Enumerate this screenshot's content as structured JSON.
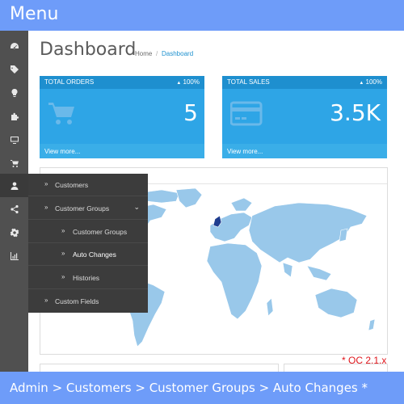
{
  "banner": {
    "title": "Menu"
  },
  "sidebar": {
    "icons": [
      {
        "name": "dashboard-icon"
      },
      {
        "name": "tags-icon"
      },
      {
        "name": "lightbulb-icon"
      },
      {
        "name": "puzzle-icon"
      },
      {
        "name": "desktop-icon"
      },
      {
        "name": "cart-icon"
      },
      {
        "name": "user-icon"
      },
      {
        "name": "share-icon"
      },
      {
        "name": "gear-icon"
      },
      {
        "name": "bar-chart-icon"
      }
    ]
  },
  "header": {
    "title": "Dashboard",
    "breadcrumb": {
      "home": "Home",
      "separator": "/",
      "current": "Dashboard"
    }
  },
  "tiles": [
    {
      "heading": "TOTAL ORDERS",
      "change": "100%",
      "value": "5",
      "link": "View more...",
      "icon": "cart-icon"
    },
    {
      "heading": "TOTAL SALES",
      "change": "100%",
      "value": "3.5K",
      "link": "View more...",
      "icon": "credit-card-icon"
    }
  ],
  "flyout": {
    "items": [
      {
        "label": "Customers",
        "level": 0
      },
      {
        "label": "Customer Groups",
        "level": 0,
        "expanded": true
      },
      {
        "label": "Customer Groups",
        "level": 1
      },
      {
        "label": "Auto Changes",
        "level": 1,
        "current": true
      },
      {
        "label": "Histories",
        "level": 1
      },
      {
        "label": "Custom Fields",
        "level": 0
      }
    ]
  },
  "note": "* OC 2.1.x",
  "footer": {
    "path": "Admin > Customers > Customer Groups > Auto Changes *"
  },
  "colors": {
    "banner": "#6e9cf9",
    "sidebar": "#505050",
    "tile_head": "#1e8fcf",
    "tile_body": "#2ea5e6",
    "map_land": "#99c8ea",
    "map_highlight": "#1f3d8f",
    "note": "#e0151b"
  }
}
